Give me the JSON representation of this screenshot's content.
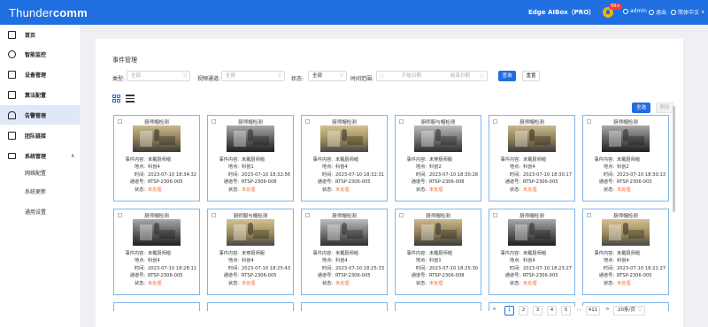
{
  "header": {
    "logo_thin": "Thunder",
    "logo_bold": "comm",
    "device_title": "Edge AIBox（PRO）",
    "notification_badge": "99+",
    "user": "admin",
    "logout": "退出",
    "language": "简体中文",
    "language_arrow": "∨"
  },
  "sidebar": {
    "items": [
      {
        "label": "首页",
        "icon": "home-icon"
      },
      {
        "label": "智能监控",
        "icon": "search-icon"
      },
      {
        "label": "设备管理",
        "icon": "device-icon"
      },
      {
        "label": "算法配置",
        "icon": "edit-icon"
      },
      {
        "label": "告警管理",
        "icon": "alarm-icon"
      },
      {
        "label": "团队链接",
        "icon": "link-icon"
      },
      {
        "label": "系统管理",
        "icon": "system-icon"
      }
    ],
    "system_sub": [
      "网络配置",
      "系统更新",
      "通用设置"
    ],
    "system_arrow": "∧"
  },
  "page": {
    "title": "事件管理",
    "filters": {
      "type_label": "类型:",
      "type_value": "全部",
      "channel_label": "视频通道:",
      "channel_value": "全部",
      "status_label": "状态:",
      "status_value": "全部",
      "time_label": "时间范围:",
      "start_placeholder": "开始日期",
      "range_sep": "-",
      "end_placeholder": "结束日期",
      "search_button": "查询",
      "reset_button": "重置"
    },
    "select_all_button": "全选",
    "delete_button": "删除"
  },
  "card_fields": {
    "content": "事件内容:",
    "location": "地点:",
    "time": "时间:",
    "channel": "通道号:",
    "status": "状态:"
  },
  "events": [
    {
      "title": "厨师帽检测",
      "content": "未戴厨师帽",
      "location": "科创4",
      "time": "2023-07-10 18:34:32",
      "channel": "RTSP-2306-005",
      "status": "未处理"
    },
    {
      "title": "厨师帽检测",
      "content": "未戴厨师帽",
      "location": "科创1",
      "time": "2023-07-10 18:32:56",
      "channel": "RTSP-2306-008",
      "status": "未处理"
    },
    {
      "title": "厨师帽检测",
      "content": "未戴厨师帽",
      "location": "科创4",
      "time": "2023-07-10 18:32:31",
      "channel": "RTSP-2306-005",
      "status": "未处理"
    },
    {
      "title": "厨师服与帽检测",
      "content": "未穿厨师服",
      "location": "科创2",
      "time": "2023-07-10 18:30:28",
      "channel": "RTSP-2306-008",
      "status": "未处理"
    },
    {
      "title": "厨师帽检测",
      "content": "未戴厨师帽",
      "location": "科创4",
      "time": "2023-07-10 18:30:17",
      "channel": "RTSP-2306-005",
      "status": "未处理"
    },
    {
      "title": "厨师帽检测",
      "content": "未戴厨师帽",
      "location": "科创2",
      "time": "2023-07-10 18:30:13",
      "channel": "RTSP-2306-003",
      "status": "未处理"
    },
    {
      "title": "厨师帽检测",
      "content": "未戴厨师帽",
      "location": "科创4",
      "time": "2023-07-10 18:28:11",
      "channel": "RTSP-2306-005",
      "status": "未处理"
    },
    {
      "title": "厨师服与帽检测",
      "content": "未穿厨师服",
      "location": "科创4",
      "time": "2023-07-10 18:25:43",
      "channel": "RTSP-2306-005",
      "status": "未处理"
    },
    {
      "title": "厨师帽检测",
      "content": "未戴厨师帽",
      "location": "科创4",
      "time": "2023-07-10 18:25:33",
      "channel": "RTSP-2306-005",
      "status": "未处理"
    },
    {
      "title": "厨师帽检测",
      "content": "未戴厨师帽",
      "location": "科创1",
      "time": "2023-07-10 18:25:30",
      "channel": "RTSP-2306-008",
      "status": "未处理"
    },
    {
      "title": "厨师帽检测",
      "content": "未戴厨师帽",
      "location": "科创4",
      "time": "2023-07-10 18:23:27",
      "channel": "RTSP-2306-005",
      "status": "未处理"
    },
    {
      "title": "厨师帽检测",
      "content": "未戴厨师帽",
      "location": "科创4",
      "time": "2023-07-10 18:21:27",
      "channel": "RTSP-2306-005",
      "status": "未处理"
    }
  ],
  "pagination": {
    "prev": "<",
    "pages": [
      "1",
      "2",
      "3",
      "4",
      "5"
    ],
    "ellipsis": "...",
    "last": "411",
    "next": ">",
    "page_size": "20条/页"
  },
  "colors": {
    "primary": "#1f6fe0",
    "status_unhandled": "#ff6a2b",
    "card_border": "#7fb6ec"
  }
}
